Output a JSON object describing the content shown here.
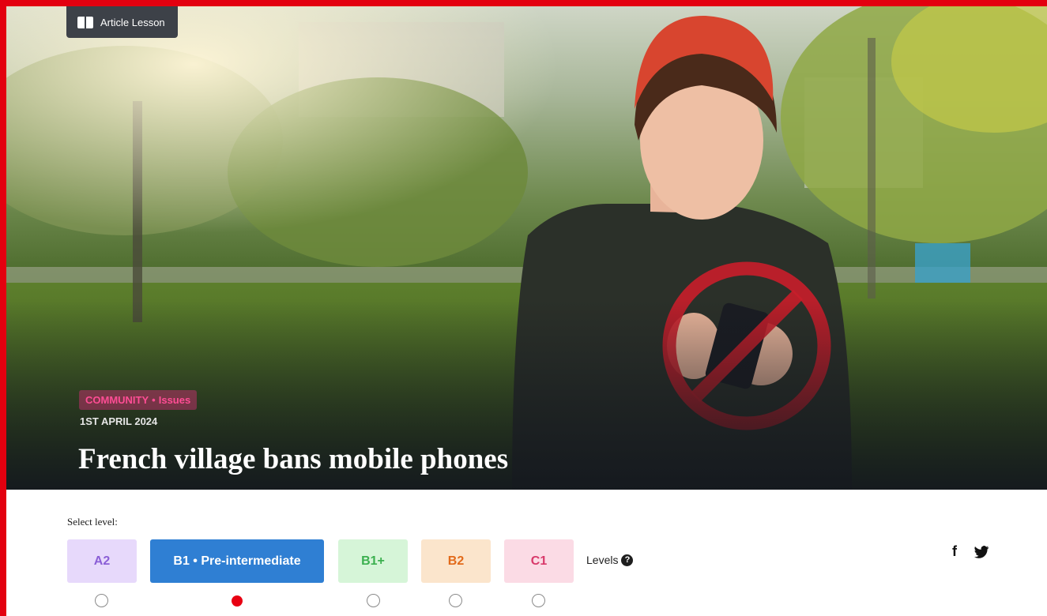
{
  "hero": {
    "badge_label": "Article Lesson",
    "category": "COMMUNITY",
    "separator": "•",
    "subcategory": "Issues",
    "date": "1ST APRIL 2024",
    "title": "French village bans mobile phones"
  },
  "level_selector": {
    "label": "Select level:",
    "levels": [
      {
        "label": "A2",
        "selected": false
      },
      {
        "label": "B1 • Pre-intermediate",
        "selected": true
      },
      {
        "label": "B1+",
        "selected": false
      },
      {
        "label": "B2",
        "selected": false
      },
      {
        "label": "C1",
        "selected": false
      }
    ],
    "help_label": "Levels",
    "help_icon": "question-circle-icon"
  },
  "social": {
    "facebook_glyph": "f",
    "twitter_icon": "twitter-icon"
  },
  "colors": {
    "frame": "#e3000f",
    "selected_level": "#2f7fd3",
    "radio_selected": "#e80012",
    "tag_pink": "#ff4d95"
  }
}
